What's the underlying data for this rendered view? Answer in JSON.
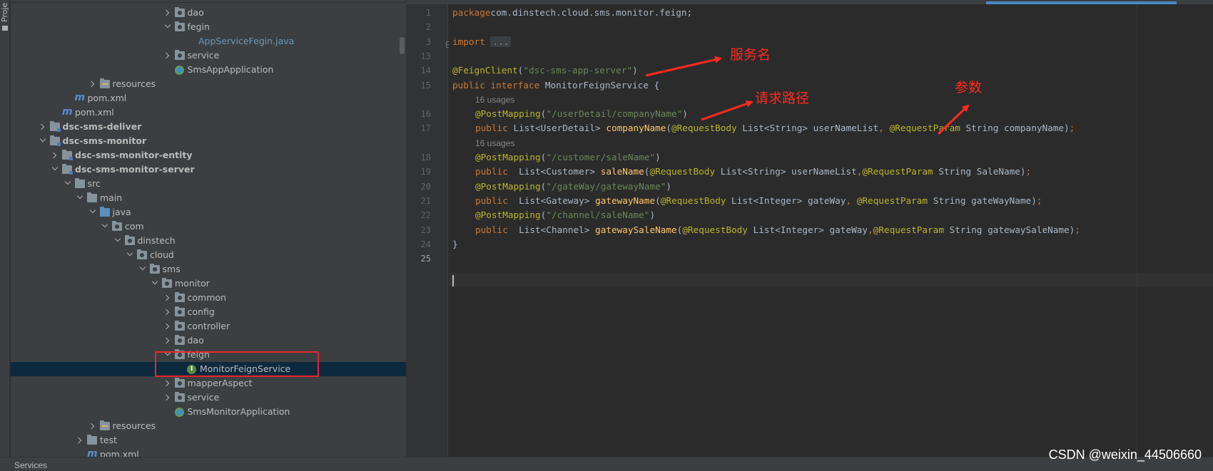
{
  "toolstrip": {
    "label": "Proje"
  },
  "tree": {
    "items": [
      {
        "label": "dao",
        "depth": 13,
        "arrow": "closed",
        "icon": "folder-pkg"
      },
      {
        "label": "fegin",
        "depth": 13,
        "arrow": "open",
        "icon": "folder-pkg"
      },
      {
        "label": "AppServiceFegin.java",
        "depth": 14,
        "arrow": "none",
        "icon": "none",
        "style": "blue"
      },
      {
        "label": "service",
        "depth": 13,
        "arrow": "closed",
        "icon": "folder-pkg"
      },
      {
        "label": "SmsAppApplication",
        "depth": 13,
        "arrow": "none",
        "icon": "spring"
      },
      {
        "label": "resources",
        "depth": 7,
        "arrow": "closed",
        "icon": "folder-res"
      },
      {
        "label": "pom.xml",
        "depth": 5,
        "arrow": "none",
        "icon": "maven"
      },
      {
        "label": "pom.xml",
        "depth": 4,
        "arrow": "none",
        "icon": "maven"
      },
      {
        "label": "dsc-sms-deliver",
        "depth": 3,
        "arrow": "closed",
        "icon": "folder-module",
        "style": "bold"
      },
      {
        "label": "dsc-sms-monitor",
        "depth": 3,
        "arrow": "open",
        "icon": "folder-module",
        "style": "bold"
      },
      {
        "label": "dsc-sms-monitor-entity",
        "depth": 4,
        "arrow": "closed",
        "icon": "folder-module",
        "style": "bold"
      },
      {
        "label": "dsc-sms-monitor-server",
        "depth": 4,
        "arrow": "open",
        "icon": "folder-module",
        "style": "bold"
      },
      {
        "label": "src",
        "depth": 5,
        "arrow": "open",
        "icon": "folder"
      },
      {
        "label": "main",
        "depth": 6,
        "arrow": "open",
        "icon": "folder"
      },
      {
        "label": "java",
        "depth": 7,
        "arrow": "open",
        "icon": "folder-src"
      },
      {
        "label": "com",
        "depth": 8,
        "arrow": "open",
        "icon": "folder-pkg"
      },
      {
        "label": "dinstech",
        "depth": 9,
        "arrow": "open",
        "icon": "folder-pkg"
      },
      {
        "label": "cloud",
        "depth": 10,
        "arrow": "open",
        "icon": "folder-pkg"
      },
      {
        "label": "sms",
        "depth": 11,
        "arrow": "open",
        "icon": "folder-pkg"
      },
      {
        "label": "monitor",
        "depth": 12,
        "arrow": "open",
        "icon": "folder-pkg"
      },
      {
        "label": "common",
        "depth": 13,
        "arrow": "closed",
        "icon": "folder-pkg"
      },
      {
        "label": "config",
        "depth": 13,
        "arrow": "closed",
        "icon": "folder-pkg"
      },
      {
        "label": "controller",
        "depth": 13,
        "arrow": "closed",
        "icon": "folder-pkg"
      },
      {
        "label": "dao",
        "depth": 13,
        "arrow": "closed",
        "icon": "folder-pkg"
      },
      {
        "label": "feign",
        "depth": 13,
        "arrow": "open",
        "icon": "folder-pkg"
      },
      {
        "label": "MonitorFeignService",
        "depth": 14,
        "arrow": "none",
        "icon": "interface",
        "selected": true
      },
      {
        "label": "mapperAspect",
        "depth": 13,
        "arrow": "closed",
        "icon": "folder-pkg"
      },
      {
        "label": "service",
        "depth": 13,
        "arrow": "closed",
        "icon": "folder-pkg"
      },
      {
        "label": "SmsMonitorApplication",
        "depth": 13,
        "arrow": "none",
        "icon": "spring"
      },
      {
        "label": "resources",
        "depth": 7,
        "arrow": "closed",
        "icon": "folder-res"
      },
      {
        "label": "test",
        "depth": 6,
        "arrow": "closed",
        "icon": "folder"
      },
      {
        "label": "pom.xml",
        "depth": 6,
        "arrow": "none",
        "icon": "maven"
      }
    ]
  },
  "editor": {
    "lines": [
      {
        "num": "1",
        "kind": "code",
        "tokens": [
          [
            "kw",
            "package"
          ],
          [
            "",
            "com.dinstech.cloud.sms.monitor.feign;"
          ]
        ]
      },
      {
        "num": "2",
        "kind": "code",
        "tokens": []
      },
      {
        "num": "3",
        "kind": "code",
        "tokens": [
          [
            "kw",
            "import"
          ],
          [
            "",
            " "
          ],
          [
            "collapsed",
            "..."
          ]
        ]
      },
      {
        "num": "13",
        "kind": "code",
        "tokens": []
      },
      {
        "num": "14",
        "kind": "code",
        "tokens": [
          [
            "an",
            "@FeignClient"
          ],
          [
            "",
            "("
          ],
          [
            "st",
            "\"dsc-sms-app-server\""
          ],
          [
            "",
            ")"
          ]
        ]
      },
      {
        "num": "15",
        "kind": "code",
        "tokens": [
          [
            "kw",
            "public interface "
          ],
          [
            "",
            "MonitorFeignService {"
          ]
        ]
      },
      {
        "num": "",
        "kind": "usage",
        "text": "16 usages"
      },
      {
        "num": "16",
        "kind": "code",
        "indent": true,
        "tokens": [
          [
            "an",
            "@PostMapping"
          ],
          [
            "",
            "("
          ],
          [
            "st",
            "\"/userDetail/companyName\""
          ],
          [
            "",
            ")"
          ]
        ]
      },
      {
        "num": "17",
        "kind": "code",
        "indent": true,
        "tokens": [
          [
            "kw",
            "public "
          ],
          [
            "",
            "List<UserDetail> "
          ],
          [
            "fn",
            "companyName"
          ],
          [
            "",
            "("
          ],
          [
            "an",
            "@RequestBody "
          ],
          [
            "",
            "List<String> userNameList"
          ],
          [
            "kw",
            ", "
          ],
          [
            "an",
            "@RequestParam "
          ],
          [
            "",
            "String companyName)"
          ],
          [
            "kw",
            ";"
          ]
        ]
      },
      {
        "num": "",
        "kind": "usage",
        "text": "16 usages"
      },
      {
        "num": "18",
        "kind": "code",
        "indent": true,
        "tokens": [
          [
            "an",
            "@PostMapping"
          ],
          [
            "",
            "("
          ],
          [
            "st",
            "\"/customer/saleName\""
          ],
          [
            "",
            ")"
          ]
        ]
      },
      {
        "num": "19",
        "kind": "code",
        "indent": true,
        "tokens": [
          [
            "kw",
            "public  "
          ],
          [
            "",
            "List<Customer> "
          ],
          [
            "fn",
            "saleName"
          ],
          [
            "",
            "("
          ],
          [
            "an",
            "@RequestBody "
          ],
          [
            "",
            "List<String> userNameList"
          ],
          [
            "kw",
            ","
          ],
          [
            "an",
            "@RequestParam "
          ],
          [
            "",
            "String SaleName)"
          ],
          [
            "kw",
            ";"
          ]
        ]
      },
      {
        "num": "20",
        "kind": "code",
        "indent": true,
        "tokens": [
          [
            "an",
            "@PostMapping"
          ],
          [
            "",
            "("
          ],
          [
            "st",
            "\"/gateWay/gatewayName\""
          ],
          [
            "",
            ")"
          ]
        ]
      },
      {
        "num": "21",
        "kind": "code",
        "indent": true,
        "tokens": [
          [
            "kw",
            "public  "
          ],
          [
            "",
            "List<Gateway> "
          ],
          [
            "fn",
            "gatewayName"
          ],
          [
            "",
            "("
          ],
          [
            "an",
            "@RequestBody "
          ],
          [
            "",
            "List<Integer> gateWay"
          ],
          [
            "kw",
            ", "
          ],
          [
            "an",
            "@RequestParam "
          ],
          [
            "",
            "String gateWayName)"
          ],
          [
            "kw",
            ";"
          ]
        ]
      },
      {
        "num": "22",
        "kind": "code",
        "indent": true,
        "tokens": [
          [
            "an",
            "@PostMapping"
          ],
          [
            "",
            "("
          ],
          [
            "st",
            "\"/channel/saleName\""
          ],
          [
            "",
            ")"
          ]
        ]
      },
      {
        "num": "23",
        "kind": "code",
        "indent": true,
        "tokens": [
          [
            "kw",
            "public  "
          ],
          [
            "",
            "List<Channel> "
          ],
          [
            "fn",
            "gatewaySaleName"
          ],
          [
            "",
            "("
          ],
          [
            "an",
            "@RequestBody "
          ],
          [
            "",
            "List<Integer> gateWay"
          ],
          [
            "kw",
            ","
          ],
          [
            "an",
            "@RequestParam "
          ],
          [
            "",
            "String gatewaySaleName)"
          ],
          [
            "kw",
            ";"
          ]
        ]
      },
      {
        "num": "24",
        "kind": "code",
        "tokens": [
          [
            "",
            "}"
          ]
        ]
      },
      {
        "num": "25",
        "kind": "code",
        "tokens": []
      }
    ]
  },
  "annotations": {
    "service_name": "服务名",
    "request_path": "请求路径",
    "params": "参数",
    "color": "#ff2a1f"
  },
  "bottombar": {
    "services_label": "Services"
  },
  "watermark": "CSDN @weixin_44506660"
}
